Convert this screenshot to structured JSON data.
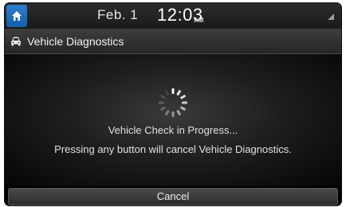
{
  "status_bar": {
    "date": "Feb.  1",
    "time": "12:03",
    "ampm": "AM",
    "home_icon": "home-icon",
    "signal_icon": "signal-icon",
    "home_color": "#1f6fbf"
  },
  "header": {
    "title": "Vehicle Diagnostics",
    "icon": "car-icon"
  },
  "main": {
    "spinner_icon": "loading-spinner-icon",
    "message_line1": "Vehicle Check in Progress...",
    "message_line2": "Pressing any button will cancel Vehicle Diagnostics."
  },
  "footer": {
    "cancel_label": "Cancel"
  }
}
